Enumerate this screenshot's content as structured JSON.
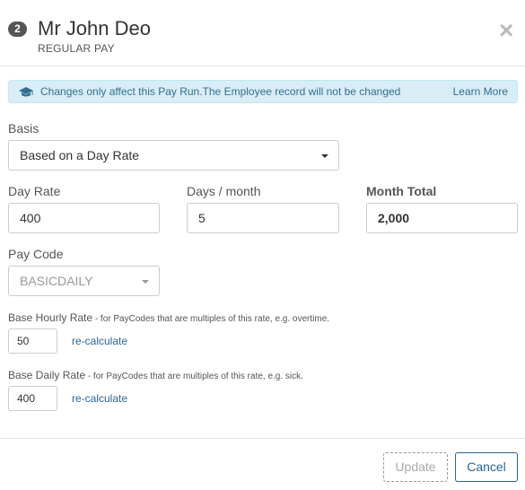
{
  "header": {
    "badge": "2",
    "title": "Mr John Deo",
    "subtitle": "REGULAR PAY",
    "close": "×"
  },
  "alert": {
    "icon": "graduation-cap-icon",
    "text": "Changes only affect this Pay Run.The Employee record will not be changed",
    "link": "Learn More"
  },
  "basis": {
    "label": "Basis",
    "value": "Based on a Day Rate"
  },
  "day_rate": {
    "label": "Day Rate",
    "value": "400"
  },
  "days_month": {
    "label": "Days / month",
    "value": "5"
  },
  "month_total": {
    "label": "Month Total",
    "value": "2,000"
  },
  "pay_code": {
    "label": "Pay Code",
    "value": "BASICDAILY"
  },
  "base_hourly": {
    "label": "Base Hourly Rate",
    "note": " - for PayCodes that are multiples of this rate, e.g. overtime.",
    "value": "50",
    "link": "re-calculate"
  },
  "base_daily": {
    "label": "Base Daily Rate",
    "note": " - for PayCodes that are multiples of this rate, e.g. sick.",
    "value": "400",
    "link": "re-calculate"
  },
  "footer": {
    "update_label": "Update",
    "cancel_label": "Cancel"
  },
  "colors": {
    "alert_bg": "#d9edf7",
    "alert_text": "#31708f",
    "link": "#2a6496"
  }
}
